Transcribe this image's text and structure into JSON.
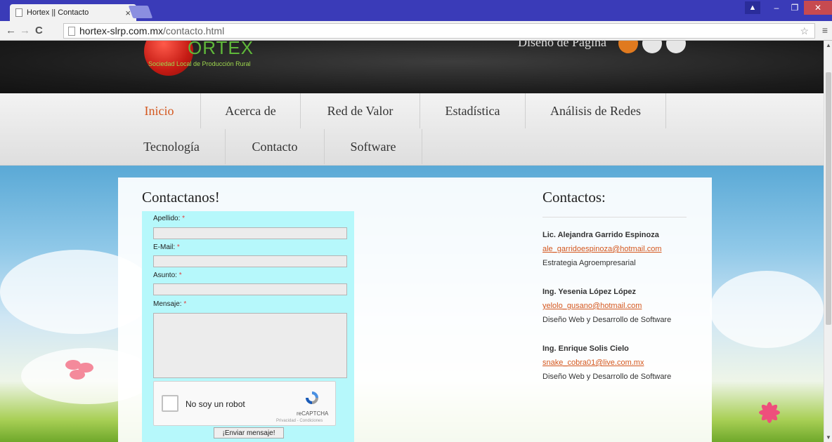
{
  "browser": {
    "tab_title": "Hortex || Contacto",
    "url_host": "hortex-slrp.com.mx",
    "url_path": "/contacto.html",
    "accent_color": "#3a3bb8"
  },
  "header": {
    "brand": "ORTEX",
    "tagline": "Sociedad Local de Producción Rural",
    "header_text": "Diseño de Página"
  },
  "nav": {
    "items": [
      {
        "label": "Inicio"
      },
      {
        "label": "Acerca de"
      },
      {
        "label": "Red de Valor"
      },
      {
        "label": "Estadística"
      },
      {
        "label": "Análisis de Redes"
      },
      {
        "label": "Tecnología"
      },
      {
        "label": "Contacto"
      },
      {
        "label": "Software"
      }
    ],
    "active_color": "#d4571e"
  },
  "form": {
    "heading": "Contactanos!",
    "fields": [
      {
        "label": "Apellido:",
        "value": ""
      },
      {
        "label": "E-Mail:",
        "value": ""
      },
      {
        "label": "Asunto:",
        "value": ""
      },
      {
        "label": "Mensaje:",
        "value": ""
      }
    ],
    "required_mark": "*",
    "captcha_label": "No soy un robot",
    "captcha_brand": "reCAPTCHA",
    "captcha_links": "Privacidad - Condiciones",
    "submit_label": "¡Enviar mensaje!",
    "background": "#b6f8fb"
  },
  "contacts": {
    "heading": "Contactos:",
    "people": [
      {
        "name": "Lic. Alejandra Garrido Espinoza",
        "email": "ale_garridoespinoza@hotmail.com",
        "role": "Estrategia Agroempresarial"
      },
      {
        "name": "Ing. Yesenia López López",
        "email": "yelolo_gusano@hotmail.com",
        "role": "Diseño Web y Desarrollo de Software"
      },
      {
        "name": "Ing. Enrique Solis Cielo",
        "email": "snake_cobra01@live.com.mx",
        "role": "Diseño Web y Desarrollo de Software"
      }
    ],
    "link_color": "#d4571e"
  }
}
